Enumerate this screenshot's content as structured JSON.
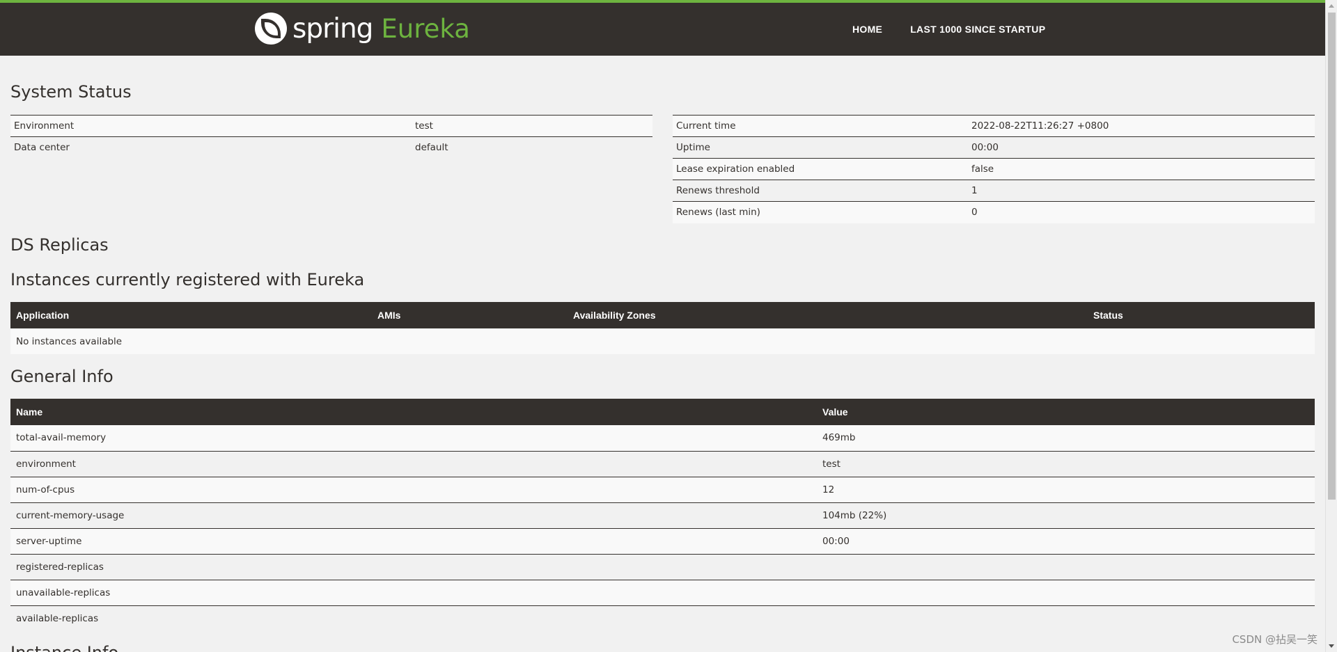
{
  "brand": {
    "spring": "spring",
    "eureka": "Eureka"
  },
  "nav": {
    "home": "HOME",
    "last1000": "LAST 1000 SINCE STARTUP"
  },
  "system_status": {
    "title": "System Status",
    "left": [
      {
        "label": "Environment",
        "value": "test"
      },
      {
        "label": "Data center",
        "value": "default"
      }
    ],
    "right": [
      {
        "label": "Current time",
        "value": "2022-08-22T11:26:27 +0800"
      },
      {
        "label": "Uptime",
        "value": "00:00"
      },
      {
        "label": "Lease expiration enabled",
        "value": "false"
      },
      {
        "label": "Renews threshold",
        "value": "1"
      },
      {
        "label": "Renews (last min)",
        "value": "0"
      }
    ]
  },
  "ds_replicas": {
    "title": "DS Replicas"
  },
  "instances": {
    "title": "Instances currently registered with Eureka",
    "columns": [
      "Application",
      "AMIs",
      "Availability Zones",
      "Status"
    ],
    "empty": "No instances available"
  },
  "general_info": {
    "title": "General Info",
    "columns": [
      "Name",
      "Value"
    ],
    "rows": [
      {
        "name": "total-avail-memory",
        "value": "469mb"
      },
      {
        "name": "environment",
        "value": "test"
      },
      {
        "name": "num-of-cpus",
        "value": "12"
      },
      {
        "name": "current-memory-usage",
        "value": "104mb (22%)"
      },
      {
        "name": "server-uptime",
        "value": "00:00"
      },
      {
        "name": "registered-replicas",
        "value": ""
      },
      {
        "name": "unavailable-replicas",
        "value": ""
      },
      {
        "name": "available-replicas",
        "value": ""
      }
    ]
  },
  "instance_info": {
    "title": "Instance Info"
  },
  "watermark": "CSDN @拈吴一笑",
  "colors": {
    "header_bg": "#34302d",
    "accent": "#6db33f",
    "page_bg": "#f1f1f1"
  }
}
